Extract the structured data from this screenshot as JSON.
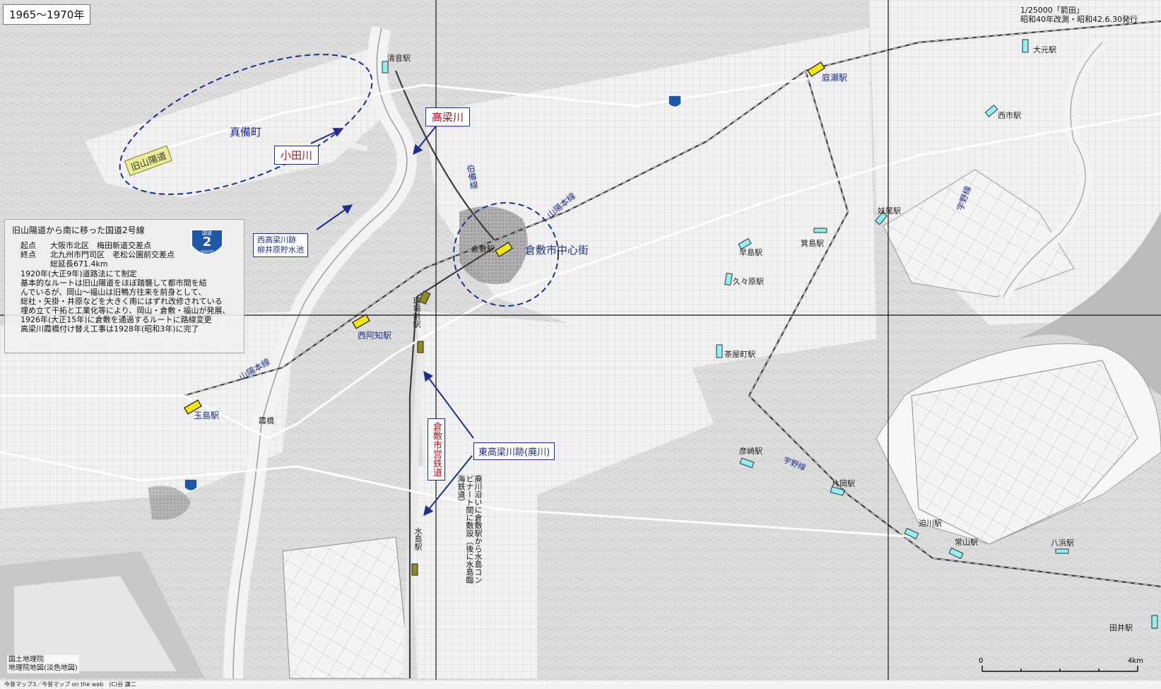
{
  "period_label": "1965〜1970年",
  "map_title": {
    "line1": "1/25000「箭田」",
    "line2": "昭和40年改測・昭和42.6.30発行"
  },
  "info_panel": {
    "heading": "旧山陽道から南に移った国道2号線",
    "start_label": "起点",
    "start_value": "大阪市北区　梅田新道交差点",
    "end_label": "終点",
    "end_value": "北九州市門司区　老松公園前交差点",
    "total_length": "総延長671.4km",
    "history": [
      "1920年(大正9年)道路法にて制定",
      "基本的なルートは旧山陽道をほぼ踏襲して都市間を結",
      "んでいるが、岡山～福山は旧鴨方往来を前身として、",
      "総社・矢掛・井原などを大きく南にはずれ改修されている",
      "埋め立て干拓と工業化等により、岡山・倉敷・福山が発展、",
      "1926年(大正15年)に倉敷を通過するルートに路線変更",
      "高梁川霞橋付け替え工事は1928年(昭和3年)に完了"
    ]
  },
  "route_shield": {
    "top": "国道",
    "number": "2",
    "bottom": "ROUTE"
  },
  "area_labels": {
    "old_sanyodo": "旧山陽道",
    "mabi": "真備町",
    "oda_river": "小田川",
    "takahashi_river": "高梁川",
    "nishi_takahashi": "西高梁川跡",
    "yanaihara": "柳井原貯水池",
    "hakubi_line": "伯備線",
    "sanyo_line_1": "山陽本線",
    "sanyo_line_2": "山陽本線",
    "kurashiki_center": "倉敷市中心街",
    "higashi_takahashi": "東高梁川跡(廃川)",
    "kurashiki_railway": "倉敷市営鉄道",
    "haisen_note": "廃川沿いに倉敷駅から水島コンビナート間に敷設（後に水島臨海鉄道）",
    "uno_line_1": "宇野線",
    "uno_line_2": "宇野線",
    "kasumi_bridge": "霞橋"
  },
  "stations": {
    "kiyone": "清音駅",
    "niwase": "庭瀬駅",
    "omoto": "大元駅",
    "nishiichi": "西市駅",
    "senoo": "妹尾駅",
    "minoshima": "箕島駅",
    "hayashima": "早島駅",
    "kubara": "久々原駅",
    "chayamachi": "茶屋町駅",
    "hikosaki": "彦崎駅",
    "kataoka": "片岡駅",
    "sakogawa": "迫川駅",
    "tsuneyama": "常山駅",
    "yahama": "八浜駅",
    "tai": "田井駅",
    "kurashiki": "倉敷駅",
    "kyujo_mae": "球場前駅",
    "nishiachi": "西阿知駅",
    "tamashima": "玉島駅",
    "mizushima": "水島駅"
  },
  "scale_bar": {
    "zero": "0",
    "max": "4km"
  },
  "credit": {
    "line1": "国土地理院",
    "line2": "地理院地図(淡色地図)"
  },
  "copyright": "今昔マップ3／今昔マップ on the web　(C)谷 謙二",
  "colors": {
    "annotation_blue": "#1c2f8a",
    "label_red": "#b0161b",
    "current_station_yellow": "#f2e600",
    "old_station_cyan": "#8ff0f0",
    "railway_olive": "#8c8c1f",
    "old_road_label": "#ecec96",
    "shield_blue": "#1f57a8"
  }
}
